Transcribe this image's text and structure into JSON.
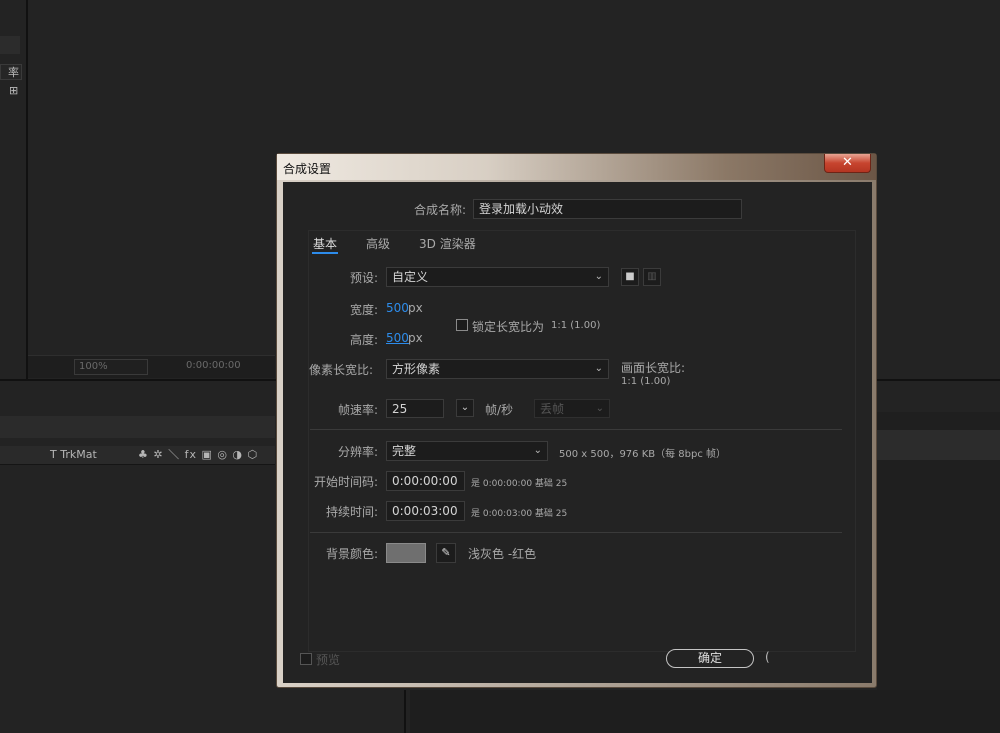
{
  "background": {
    "cut_tab": "率",
    "zoom": "100%",
    "timecode": "0:00:00:00",
    "trkmat": "T  TrkMat",
    "switch_icons": "♣ ✲ ＼ fx ▣ ◎ ◑ ⬡"
  },
  "dialog": {
    "title": "合成设置",
    "close_label": "✕",
    "name_label": "合成名称:",
    "name_value": "登录加载小动效",
    "tabs": [
      "基本",
      "高级",
      "3D 渲染器"
    ],
    "preset_label": "预设:",
    "preset_value": "自定义",
    "width_label": "宽度:",
    "width_value": "500",
    "height_label": "高度:",
    "height_value": "500",
    "unit_px": "px",
    "lock_label": "锁定长宽比为",
    "lock_ratio": "1:1 (1.00)",
    "par_label": "像素长宽比:",
    "par_value": "方形像素",
    "frame_aspect_label": "画面长宽比:",
    "frame_aspect_value": "1:1 (1.00)",
    "fps_label": "帧速率:",
    "fps_value": "25",
    "fps_unit": "帧/秒",
    "drop_frame": "丢帧",
    "res_label": "分辨率:",
    "res_value": "完整",
    "res_info": "500 x 500，976 KB（每 8bpc 帧）",
    "start_label": "开始时间码:",
    "start_value": "0:00:00:00",
    "start_note": "是 0:00:00:00  基础 25",
    "duration_label": "持续时间:",
    "duration_value": "0:00:03:00",
    "duration_note": "是 0:00:03:00  基础 25",
    "bg_label": "背景颜色:",
    "bg_name": "浅灰色 -红色",
    "bg_color": "#6f6f6f",
    "preview_label": "预览",
    "ok_label": "确定"
  }
}
